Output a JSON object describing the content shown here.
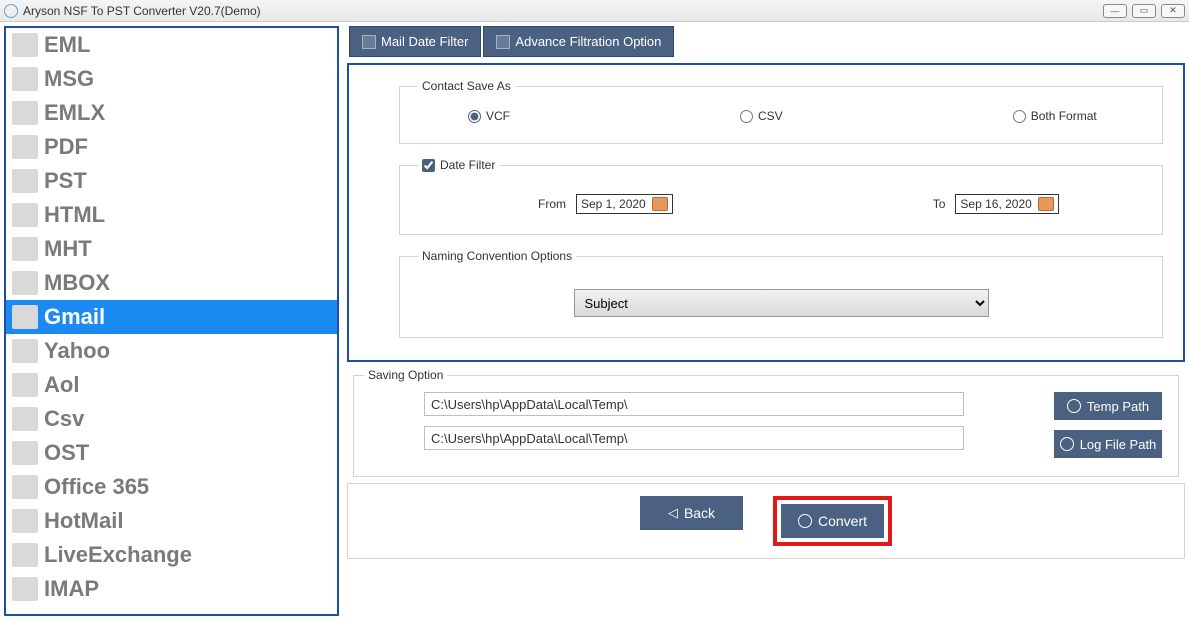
{
  "window": {
    "title": "Aryson NSF To PST Converter V20.7(Demo)"
  },
  "sidebar": {
    "items": [
      {
        "label": "EML"
      },
      {
        "label": "MSG"
      },
      {
        "label": "EMLX"
      },
      {
        "label": "PDF"
      },
      {
        "label": "PST"
      },
      {
        "label": "HTML"
      },
      {
        "label": "MHT"
      },
      {
        "label": "MBOX"
      },
      {
        "label": "Gmail"
      },
      {
        "label": "Yahoo"
      },
      {
        "label": "Aol"
      },
      {
        "label": "Csv"
      },
      {
        "label": "OST"
      },
      {
        "label": "Office 365"
      },
      {
        "label": "HotMail"
      },
      {
        "label": "LiveExchange"
      },
      {
        "label": "IMAP"
      }
    ],
    "selected_index": 8
  },
  "tabs": {
    "mail_date": "Mail Date Filter",
    "advance": "Advance Filtration Option"
  },
  "contact_save_as": {
    "legend": "Contact Save As",
    "vcf": "VCF",
    "csv": "CSV",
    "both": "Both Format",
    "selected": "vcf"
  },
  "date_filter": {
    "legend": "Date Filter",
    "checked": true,
    "from_label": "From",
    "from_value": "Sep 1, 2020",
    "to_label": "To",
    "to_value": "Sep 16, 2020"
  },
  "naming": {
    "legend": "Naming Convention Options",
    "value": "Subject"
  },
  "saving": {
    "legend": "Saving Option",
    "temp_path": "C:\\Users\\hp\\AppData\\Local\\Temp\\",
    "log_path": "C:\\Users\\hp\\AppData\\Local\\Temp\\",
    "temp_btn": "Temp Path",
    "log_btn": "Log File Path"
  },
  "footer": {
    "back": "Back",
    "convert": "Convert"
  }
}
